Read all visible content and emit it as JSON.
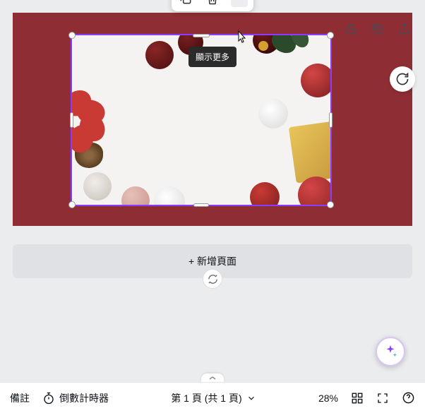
{
  "toolbar": {
    "more_tooltip": "顯示更多"
  },
  "add_page_label": "+ 新增頁面",
  "bottom_bar": {
    "notes_label": "備註",
    "timer_label": "倒數計時器",
    "page_indicator": "第 1 頁 (共 1 頁)",
    "zoom_level": "28%"
  },
  "colors": {
    "page_bg": "#8e2e34",
    "selection": "#8b3dff"
  }
}
